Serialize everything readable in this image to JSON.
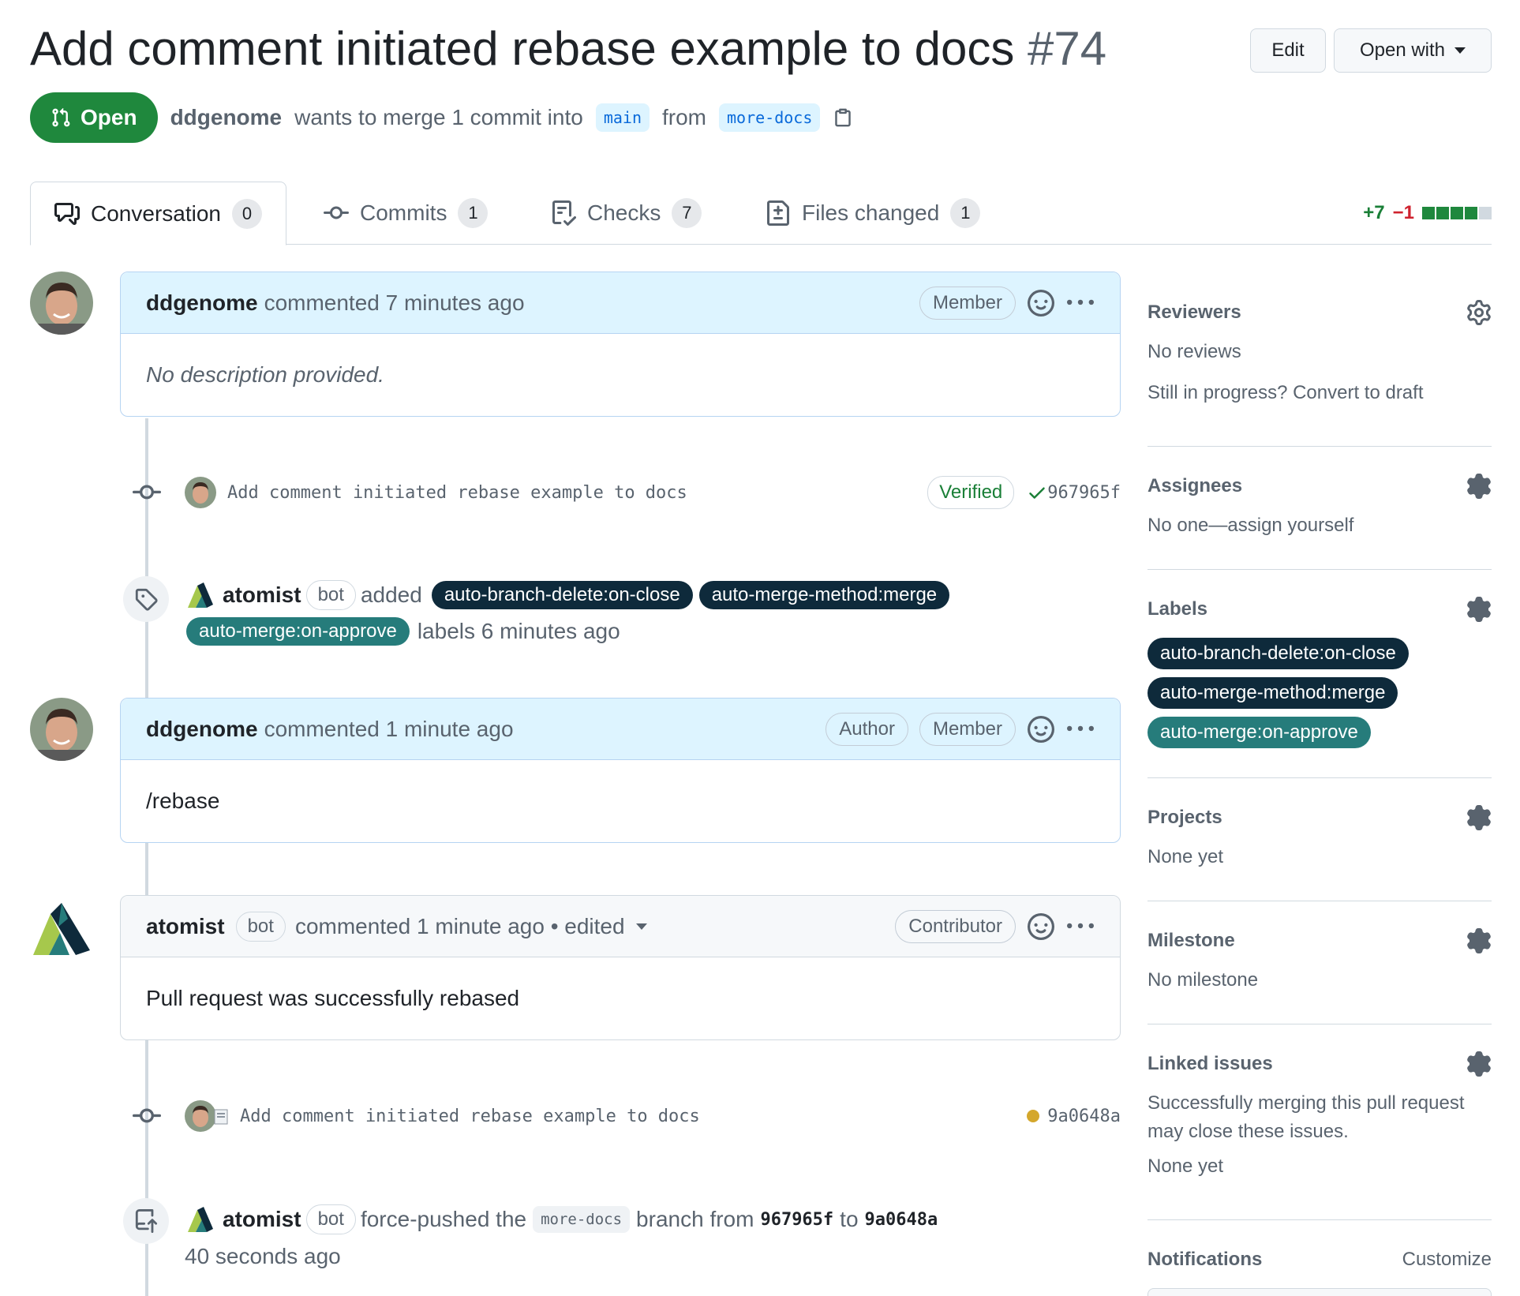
{
  "header": {
    "title": "Add comment initiated rebase example to docs",
    "number": "#74",
    "edit_label": "Edit",
    "open_with_label": "Open with"
  },
  "meta": {
    "state": "Open",
    "author": "ddgenome",
    "text_merge": "wants to merge 1 commit into",
    "base_branch": "main",
    "text_from": "from",
    "head_branch": "more-docs"
  },
  "tabs": [
    {
      "label": "Conversation",
      "count": "0"
    },
    {
      "label": "Commits",
      "count": "1"
    },
    {
      "label": "Checks",
      "count": "7"
    },
    {
      "label": "Files changed",
      "count": "1"
    }
  ],
  "diffstat": {
    "additions": "+7",
    "deletions": "−1"
  },
  "timeline": {
    "comment1": {
      "author": "ddgenome",
      "action": "commented 7 minutes ago",
      "role": "Member",
      "body": "No description provided."
    },
    "commit1": {
      "message": "Add comment initiated rebase example to docs",
      "verified": "Verified",
      "sha": "967965f"
    },
    "labels_event": {
      "actor": "atomist",
      "bot": "bot",
      "verb": "added",
      "labels": [
        "auto-branch-delete:on-close",
        "auto-merge-method:merge",
        "auto-merge:on-approve"
      ],
      "suffix": "labels 6 minutes ago"
    },
    "comment2": {
      "author": "ddgenome",
      "action": "commented 1 minute ago",
      "role1": "Author",
      "role2": "Member",
      "body": "/rebase"
    },
    "comment3": {
      "author": "atomist",
      "bot": "bot",
      "action": "commented 1 minute ago • edited",
      "role": "Contributor",
      "body": "Pull request was successfully rebased"
    },
    "commit2": {
      "message": "Add comment initiated rebase example to docs",
      "sha": "9a0648a"
    },
    "push_event": {
      "actor": "atomist",
      "bot": "bot",
      "verb": "force-pushed the",
      "branch": "more-docs",
      "mid": "branch from",
      "from_sha": "967965f",
      "to": "to",
      "to_sha": "9a0648a",
      "time": "40 seconds ago"
    }
  },
  "sidebar": {
    "reviewers": {
      "title": "Reviewers",
      "line1": "No reviews",
      "line2": "Still in progress? Convert to draft"
    },
    "assignees": {
      "title": "Assignees",
      "line1": "No one—assign yourself"
    },
    "labels": {
      "title": "Labels",
      "items": [
        "auto-branch-delete:on-close",
        "auto-merge-method:merge",
        "auto-merge:on-approve"
      ]
    },
    "projects": {
      "title": "Projects",
      "line1": "None yet"
    },
    "milestone": {
      "title": "Milestone",
      "line1": "No milestone"
    },
    "linked": {
      "title": "Linked issues",
      "line1": "Successfully merging this pull request may close these issues.",
      "line2": "None yet"
    },
    "notifications": {
      "title": "Notifications",
      "customize": "Customize"
    }
  },
  "colors": {
    "open_green": "#1f883d",
    "label_dark": "#0e2a3b",
    "label_teal": "#267c7b",
    "pending_yellow": "#d4a72c"
  }
}
